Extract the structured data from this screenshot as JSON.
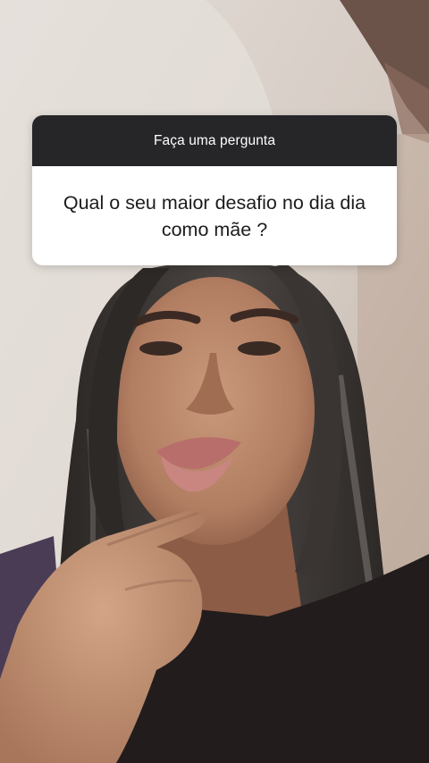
{
  "story": {
    "background_description": "",
    "question_sticker": {
      "prompt": "Faça uma pergunta",
      "question": "Qual o seu maior desafio no dia dia como mãe ?",
      "header_color": "#262629",
      "body_color": "#ffffff"
    }
  }
}
